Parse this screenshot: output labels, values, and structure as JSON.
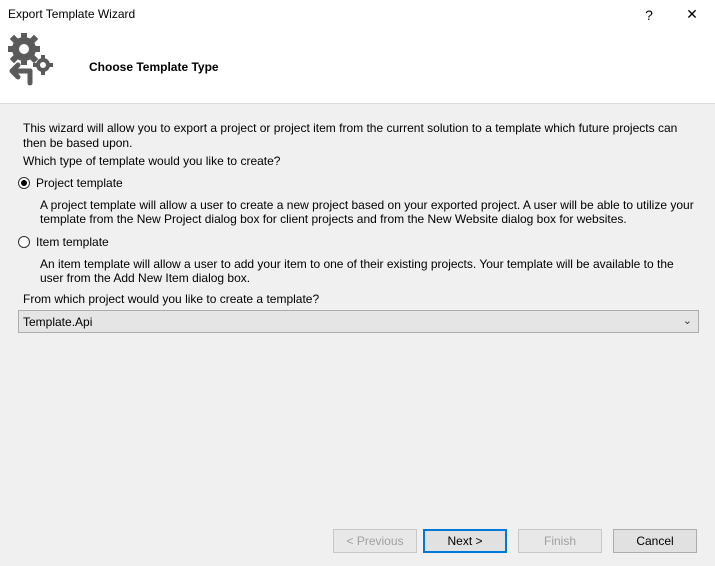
{
  "window": {
    "title": "Export Template Wizard",
    "help_glyph": "?",
    "close_glyph": "✕"
  },
  "header": {
    "title": "Choose Template Type",
    "icon": "gears-export-icon"
  },
  "body": {
    "intro": "This wizard will allow you to export a project or project item from the current solution to a template which future projects can then be based upon.",
    "question_type": "Which type of template would you like to create?",
    "options": [
      {
        "label": "Project template",
        "checked": true,
        "description": "A project template will allow a user to create a new project based on your exported project. A user will be able to utilize your template from the New Project dialog box for client projects and from the New Website dialog box for websites."
      },
      {
        "label": "Item template",
        "checked": false,
        "description": "An item template will allow a user to add your item to one of their existing projects. Your template will be available to the user from the Add New Item dialog box."
      }
    ],
    "question_project": "From which project would you like to create a template?",
    "project_select": {
      "selected": "Template.Api",
      "arrow": "⌄"
    }
  },
  "buttons": {
    "previous": "< Previous",
    "next": "Next >",
    "finish": "Finish",
    "cancel": "Cancel"
  },
  "colors": {
    "accent": "#0078d7",
    "icon_gray": "#5a5a5a"
  }
}
